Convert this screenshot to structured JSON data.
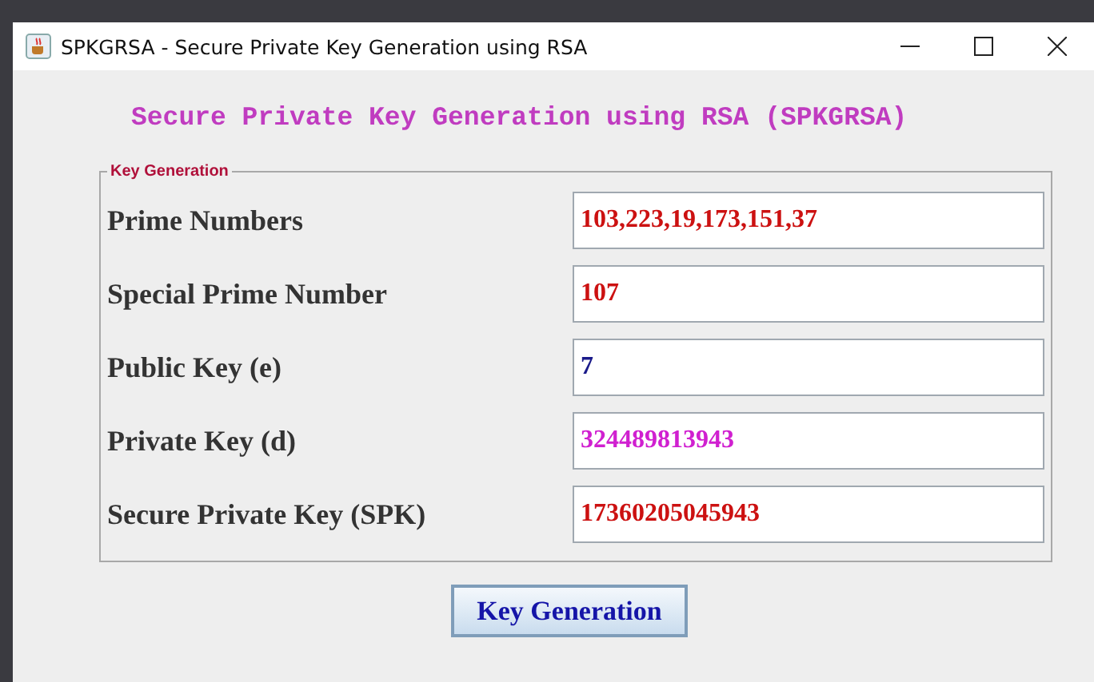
{
  "window": {
    "title": "SPKGRSA - Secure Private Key Generation using RSA"
  },
  "heading": "Secure Private Key Generation using RSA (SPKGRSA)",
  "group": {
    "legend": "Key Generation",
    "fields": [
      {
        "label": "Prime Numbers",
        "value": "103,223,19,173,151,37",
        "color": "#cc1111"
      },
      {
        "label": "Special Prime Number",
        "value": "107",
        "color": "#cc1111"
      },
      {
        "label": "Public Key (e)",
        "value": "7",
        "color": "#1a1a8a"
      },
      {
        "label": "Private Key (d)",
        "value": "324489813943",
        "color": "#d020d0"
      },
      {
        "label": "Secure Private Key (SPK)",
        "value": "17360205045943",
        "color": "#cc1111"
      }
    ]
  },
  "button": "Key Generation"
}
